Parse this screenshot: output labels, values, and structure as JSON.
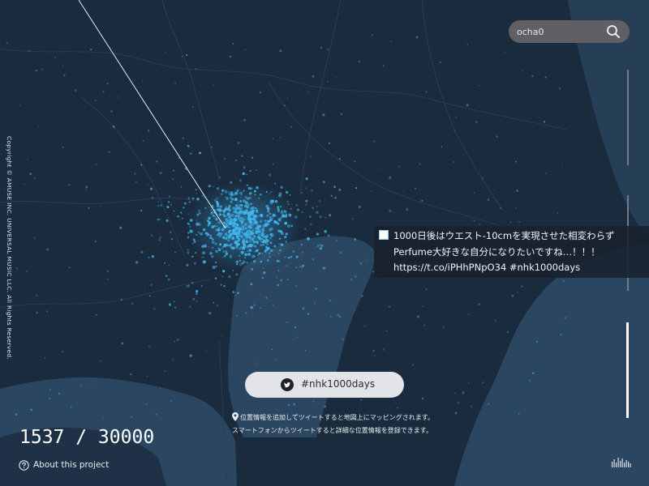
{
  "copyright": "Copyright © AMUSE INC. UNIVERSAL MUSIC LLC. All Rights Reserved.",
  "search": {
    "value": "ocha0",
    "icon": "search-icon"
  },
  "tweet": {
    "lines": [
      "1000日後はウエスト-10cmを実現させた相変わらず",
      "Perfume大好きな自分になりたいですね…！！！",
      "https://t.co/iPHhPNpO34 #nhk1000days"
    ]
  },
  "hashtag_button": {
    "label": "#nhk1000days",
    "icon": "twitter-icon"
  },
  "info": {
    "line1": "位置情報を追加してツイートすると地図上にマッピングされます。",
    "line2": "スマートフォンからツイートすると詳細な位置情報を登録できます。"
  },
  "counter": {
    "text": "1537 / 30000"
  },
  "about": {
    "label": "About this project"
  },
  "colors": {
    "land": "#1a2b3e",
    "sea": "#2b4660",
    "point": "#43b6ee",
    "panel": "#18222e"
  }
}
